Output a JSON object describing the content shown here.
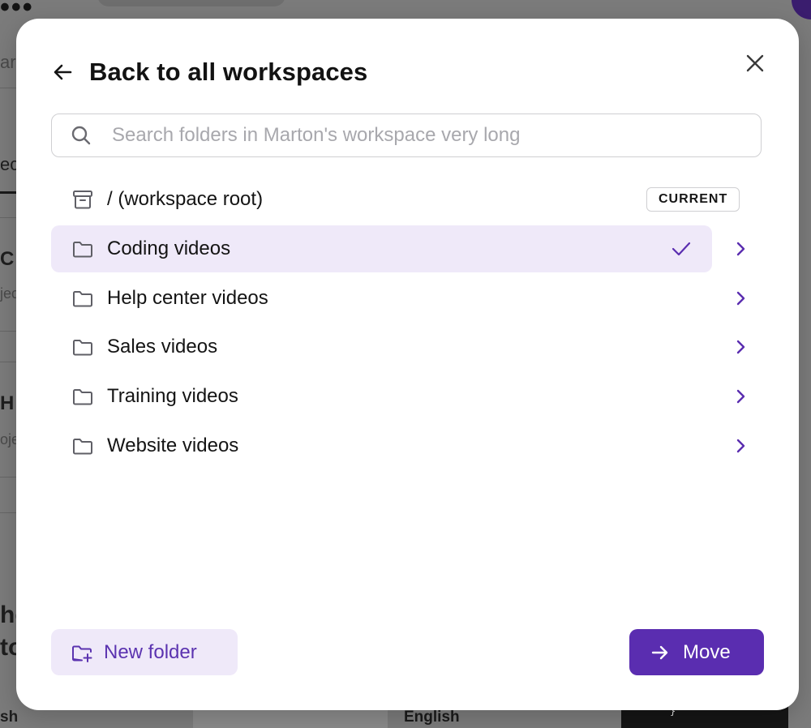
{
  "background": {
    "logo": "•••",
    "fragments": [
      "ar",
      "ec",
      "C",
      "jec",
      "H",
      "oje",
      "he",
      "to",
      "sh"
    ],
    "bottom_label": "English",
    "code_snippet": "}"
  },
  "modal": {
    "back_label": "Back to all workspaces",
    "search": {
      "placeholder": "Search folders in Marton's workspace very long",
      "value": ""
    },
    "root_item": {
      "label": "/ (workspace root)",
      "icon": "archive-icon",
      "badge": "CURRENT"
    },
    "folders": [
      {
        "label": "Coding videos",
        "icon": "folder-icon",
        "selected": true
      },
      {
        "label": "Help center videos",
        "icon": "folder-icon",
        "selected": false
      },
      {
        "label": "Sales videos",
        "icon": "folder-icon",
        "selected": false
      },
      {
        "label": "Training videos",
        "icon": "folder-icon",
        "selected": false
      },
      {
        "label": "Website videos",
        "icon": "folder-icon",
        "selected": false
      }
    ],
    "new_folder_label": "New folder",
    "move_label": "Move"
  },
  "colors": {
    "accent": "#5a2db0",
    "selected_bg": "#efe9f9",
    "overlay": "#7b7b7b"
  }
}
